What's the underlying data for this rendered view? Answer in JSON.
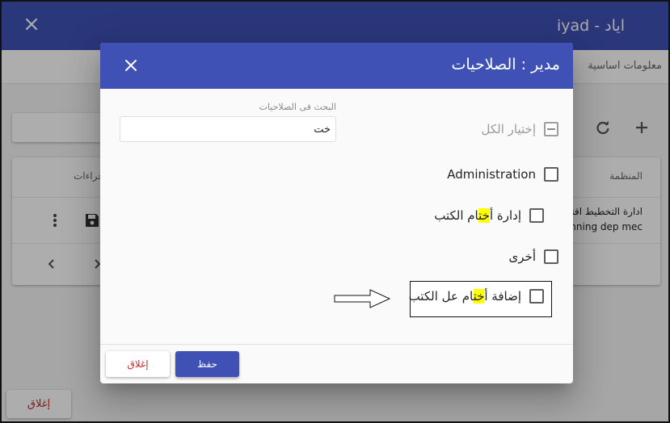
{
  "background": {
    "window_title": "اياد - iyad",
    "tab_label": "معلومات اساسية",
    "table": {
      "header_org": "المنظمة",
      "header_actions": "جراءات",
      "row_org_line1": "ادارة التخطيط اقتصادي",
      "row_org_line2": "planning dep mec"
    },
    "close_button": "إغلاق"
  },
  "dialog": {
    "title": "مدير : الصلاحيات",
    "search": {
      "label": "البحث فى الصلاحيات",
      "value": "خت"
    },
    "select_all": "إختيار الكل",
    "permissions": [
      {
        "pre": "Administration",
        "hl": "",
        "post": ""
      },
      {
        "pre": "إدارة أ",
        "hl": "خت",
        "post": "ام الكتب"
      },
      {
        "pre": "أخرى",
        "hl": "",
        "post": ""
      },
      {
        "pre": "إضافة أ",
        "hl": "خت",
        "post": "ام عل الكتب"
      }
    ],
    "save_button": "حفظ",
    "close_button": "إغلاق"
  },
  "colors": {
    "primary": "#3f51b5",
    "highlight": "#ffff00",
    "danger_text": "#c62828"
  },
  "icons": [
    "close-icon",
    "refresh-icon",
    "add-icon",
    "save-icon",
    "more-vert-icon",
    "chevron-left-icon",
    "chevron-right-icon",
    "arrow-right-icon"
  ]
}
